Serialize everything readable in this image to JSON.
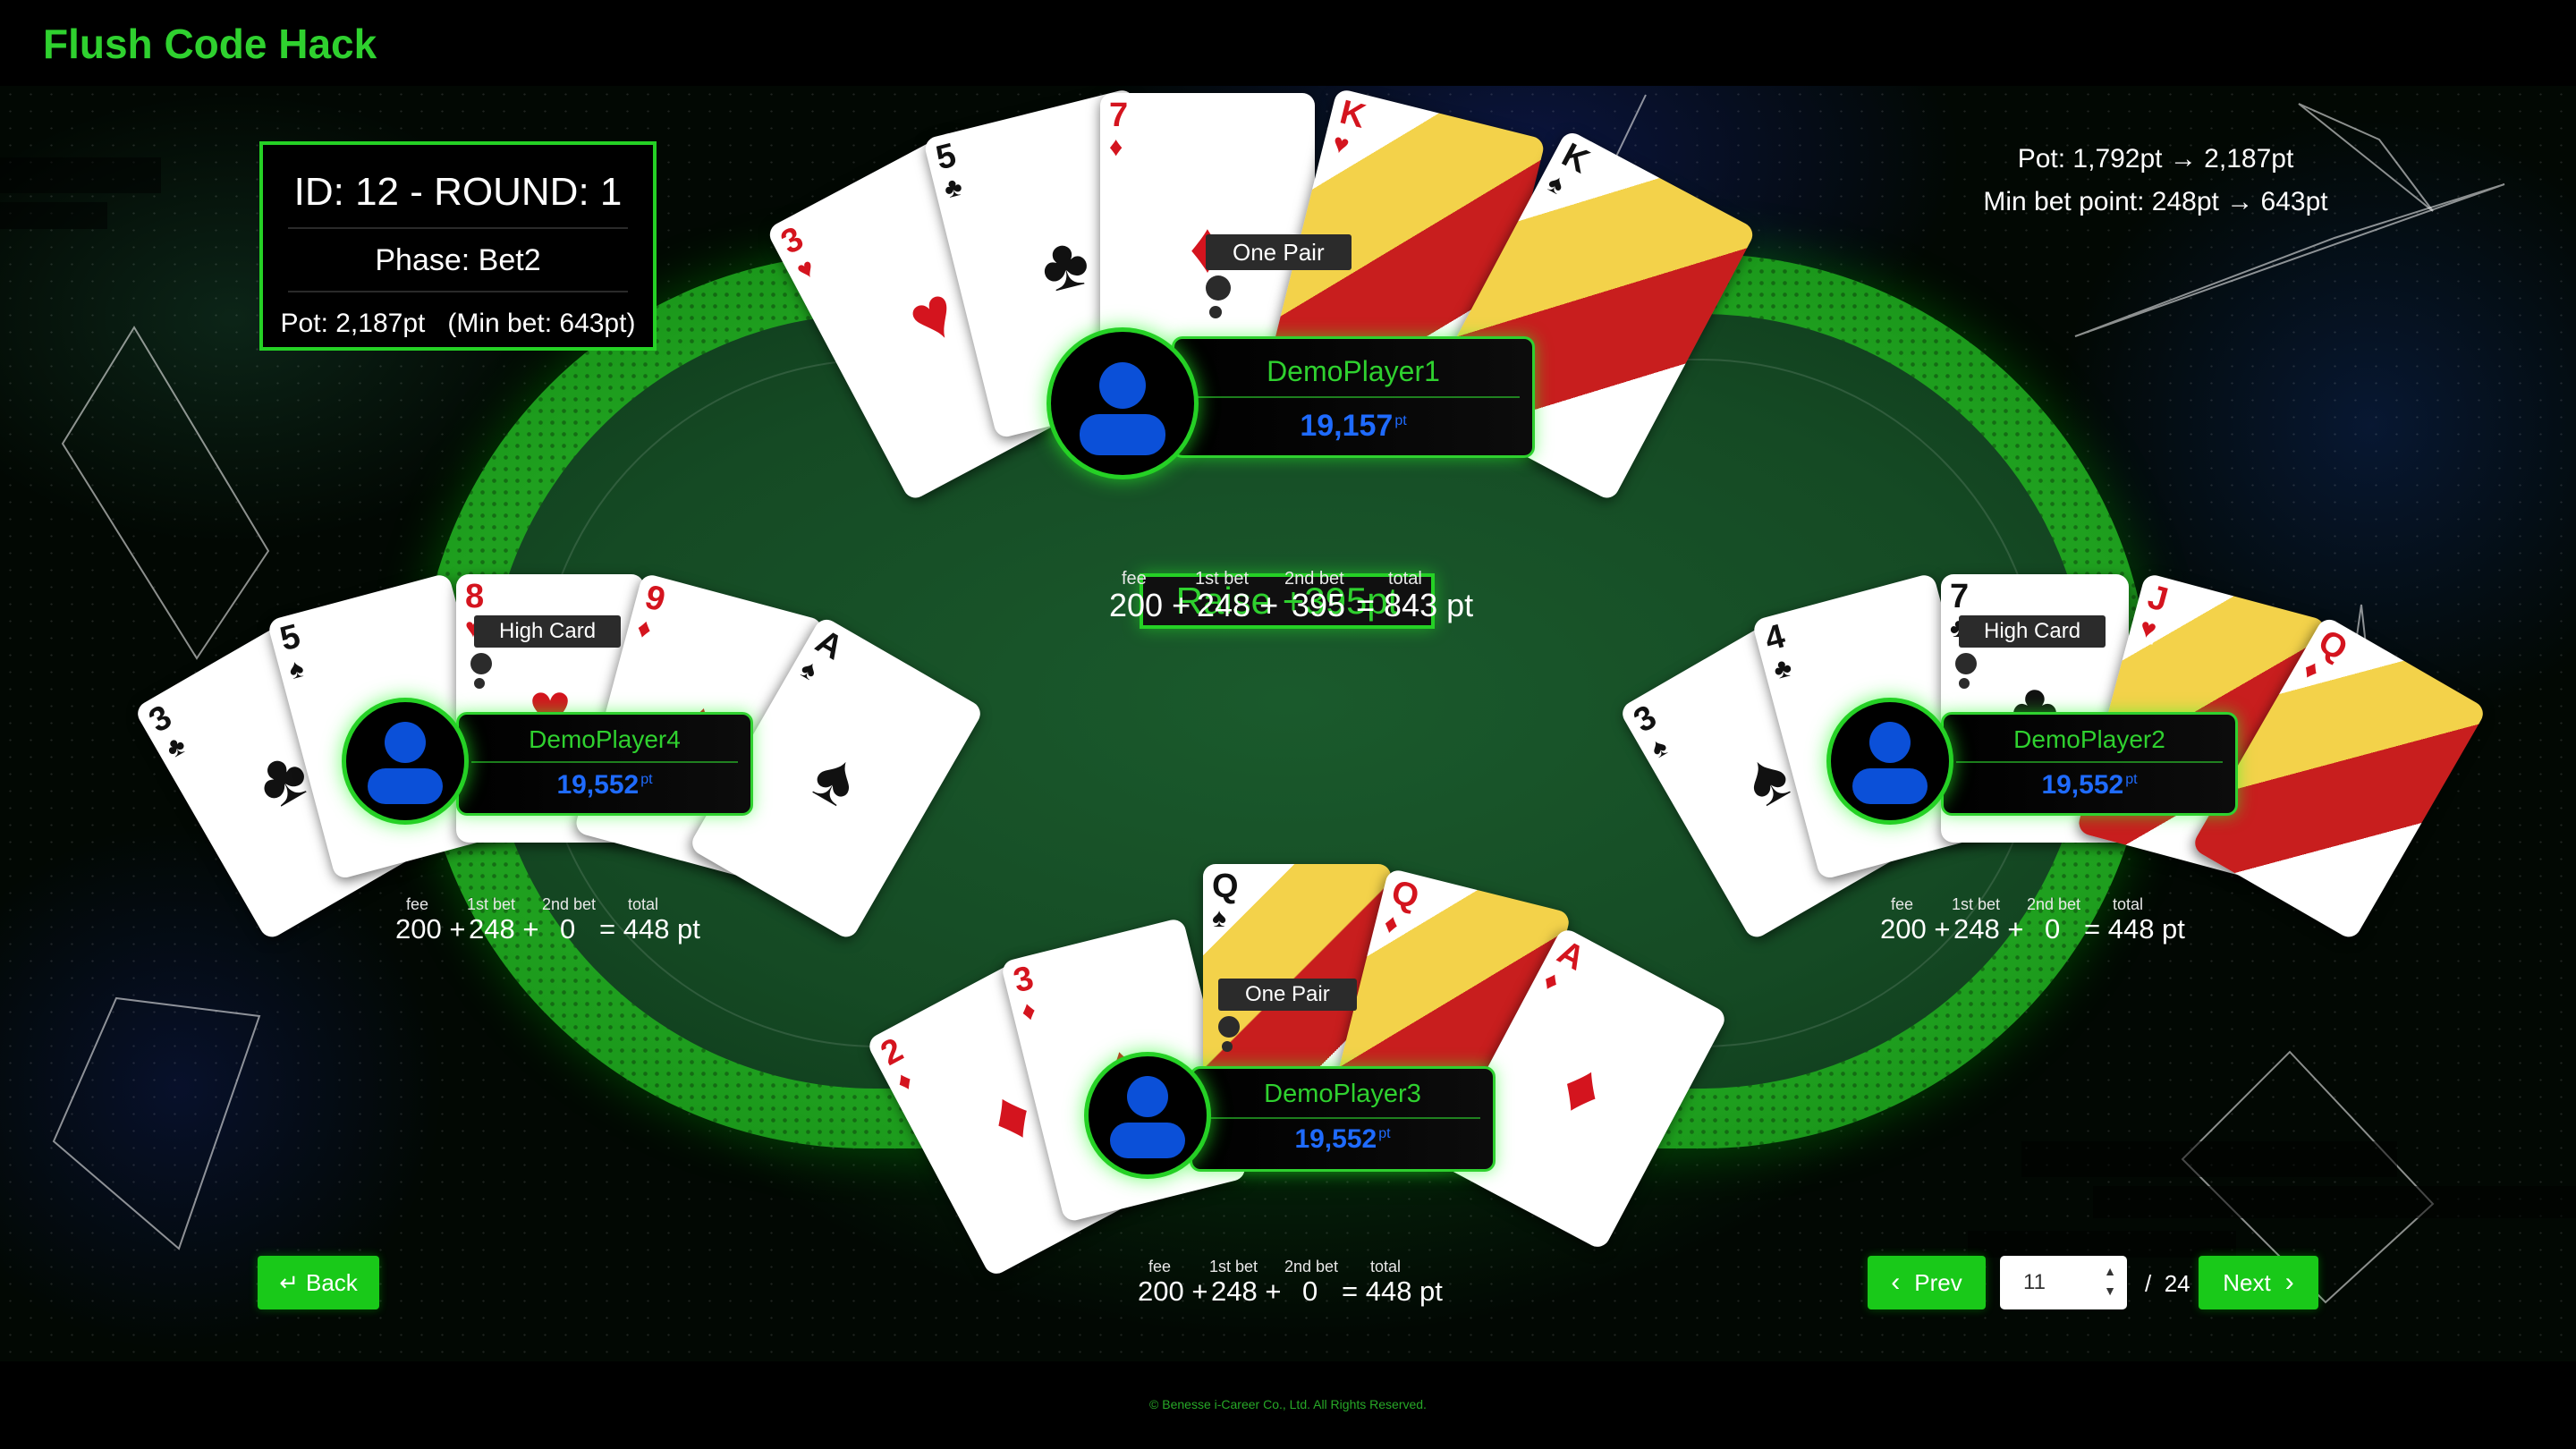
{
  "app": {
    "title": "Flush Code Hack"
  },
  "game_info": {
    "id_round": "ID: 12 - ROUND: 1",
    "phase": "Phase: Bet2",
    "pot_line": "Pot: 2,187pt   (Min bet: 643pt)"
  },
  "pot_summary": {
    "pot": "Pot: 1,792pt → 2,187pt",
    "min_bet": "Min bet point: 248pt → 643pt"
  },
  "bet_labels": {
    "fee": "fee",
    "first": "1st bet",
    "second": "2nd bet",
    "total": "total"
  },
  "players": {
    "p1": {
      "name": "DemoPlayer1",
      "points": "19,157",
      "unit": "pt",
      "hand": "One Pair",
      "action": "Raise +395pt",
      "cards": [
        {
          "rank": "3",
          "suit": "♥"
        },
        {
          "rank": "5",
          "suit": "♣"
        },
        {
          "rank": "7",
          "suit": "♦"
        },
        {
          "rank": "K",
          "suit": "♥"
        },
        {
          "rank": "K",
          "suit": "♠"
        }
      ],
      "bets": {
        "fee": "200 +",
        "first": "248 +",
        "second": "395",
        "total": "= 843 pt"
      }
    },
    "p2": {
      "name": "DemoPlayer2",
      "points": "19,552",
      "unit": "pt",
      "hand": "High Card",
      "cards": [
        {
          "rank": "3",
          "suit": "♠"
        },
        {
          "rank": "4",
          "suit": "♣"
        },
        {
          "rank": "7",
          "suit": "♣"
        },
        {
          "rank": "J",
          "suit": "♥"
        },
        {
          "rank": "Q",
          "suit": "♦"
        }
      ],
      "bets": {
        "fee": "200 +",
        "first": "248 +",
        "second": "0",
        "total": "= 448 pt"
      }
    },
    "p3": {
      "name": "DemoPlayer3",
      "points": "19,552",
      "unit": "pt",
      "hand": "One Pair",
      "cards": [
        {
          "rank": "2",
          "suit": "♦"
        },
        {
          "rank": "3",
          "suit": "♦"
        },
        {
          "rank": "Q",
          "suit": "♠"
        },
        {
          "rank": "Q",
          "suit": "♦"
        },
        {
          "rank": "A",
          "suit": "♦"
        }
      ],
      "bets": {
        "fee": "200 +",
        "first": "248 +",
        "second": "0",
        "total": "= 448 pt"
      }
    },
    "p4": {
      "name": "DemoPlayer4",
      "points": "19,552",
      "unit": "pt",
      "hand": "High Card",
      "cards": [
        {
          "rank": "3",
          "suit": "♣"
        },
        {
          "rank": "5",
          "suit": "♠"
        },
        {
          "rank": "8",
          "suit": "♥"
        },
        {
          "rank": "9",
          "suit": "♦"
        },
        {
          "rank": "A",
          "suit": "♠"
        }
      ],
      "bets": {
        "fee": "200 +",
        "first": "248 +",
        "second": "0",
        "total": "= 448 pt"
      }
    }
  },
  "nav": {
    "back_icon": "↵",
    "back_label": "Back",
    "prev_icon": "‹",
    "prev_label": "Prev",
    "next_label": "Next",
    "next_icon": "›",
    "page_current": "11",
    "page_sep": "/",
    "page_total": "24"
  },
  "footer": {
    "copyright": "© Benesse i-Career Co., Ltd. All Rights Reserved."
  },
  "colors": {
    "accent": "#2fd12f",
    "points": "#1f6bff",
    "felt": "#154a24"
  }
}
